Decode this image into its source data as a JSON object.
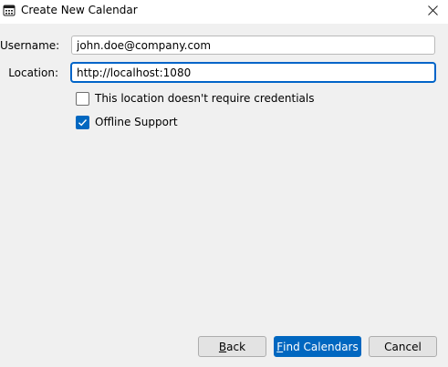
{
  "window": {
    "title": "Create New Calendar",
    "icon": "calendar-icon",
    "close_icon": "close-icon"
  },
  "form": {
    "username": {
      "label": "Username:",
      "value": "john.doe@company.com"
    },
    "location": {
      "label": "Location:",
      "value": "http://localhost:1080"
    }
  },
  "options": {
    "no_credentials": {
      "label": "This location doesn't require credentials",
      "checked": false
    },
    "offline_support": {
      "label": "Offline Support",
      "checked": true
    }
  },
  "buttons": {
    "back": {
      "mnemonic": "B",
      "rest": "ack"
    },
    "find": {
      "mnemonic": "F",
      "rest": "ind Calendars"
    },
    "cancel": {
      "label": "Cancel"
    }
  },
  "colors": {
    "accent": "#0067c0",
    "background": "#f0f0f0",
    "focus_border": "#0064c8"
  }
}
